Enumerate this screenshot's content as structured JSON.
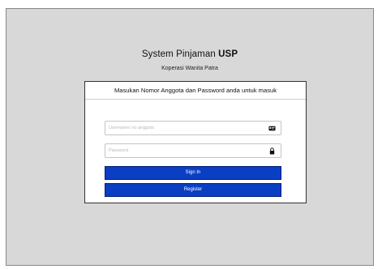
{
  "header": {
    "title_main": "System Pinjaman ",
    "title_strong": "USP",
    "subtitle": "Koperasi Wanita Patra"
  },
  "login": {
    "instruction": "Masukan Nomor Anggota dan Password anda untuk masuk",
    "username": {
      "value": "",
      "placeholder": "Username/ no anggota",
      "icon": "id-card-icon"
    },
    "password": {
      "value": "",
      "placeholder": "Password",
      "icon": "lock-icon"
    },
    "signin_label": "Sign In",
    "register_label": "Register"
  },
  "colors": {
    "background": "#d8d8d8",
    "button": "#0a3fc4"
  }
}
